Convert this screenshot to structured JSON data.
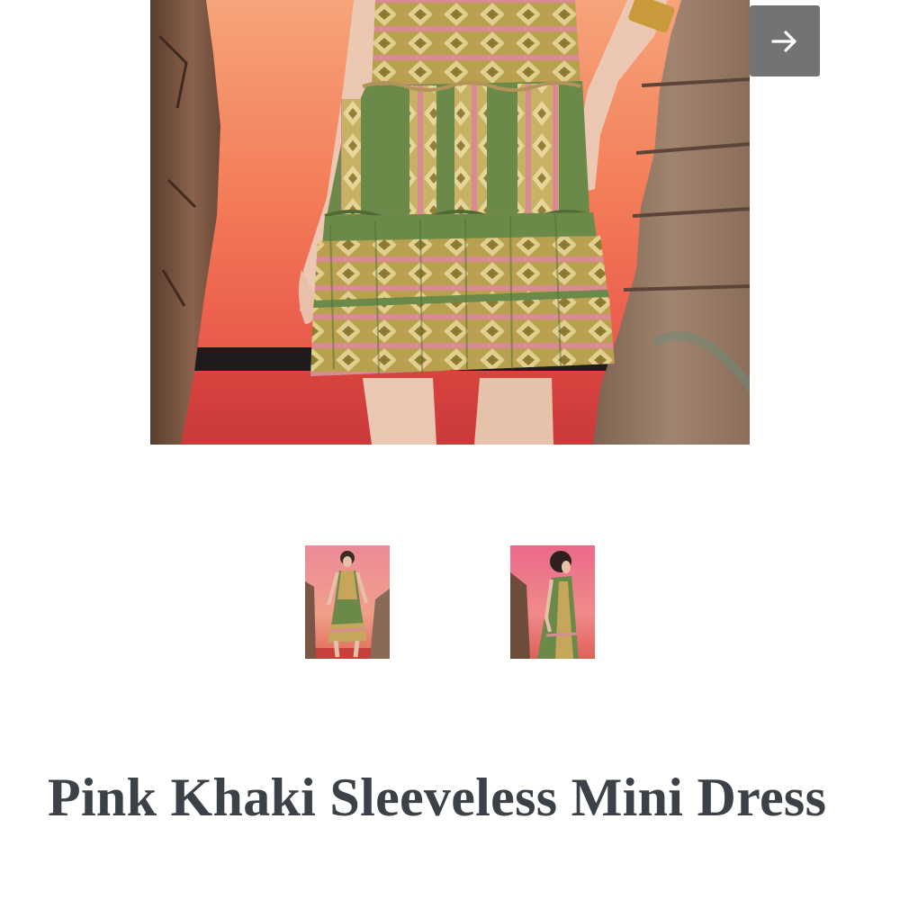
{
  "gallery": {
    "main_image_alt": "",
    "next_button_icon": "arrow-right-icon",
    "thumbnails": [
      {
        "view": "front"
      },
      {
        "view": "back"
      }
    ]
  },
  "product": {
    "title": "Pink Khaki Sleeveless Mini Dress"
  },
  "colors": {
    "title_text": "#3c4148",
    "next_button_bg": "#737373",
    "dress_khaki": "#6b8a4a",
    "dress_pink": "#d98a94",
    "background_orange": "#ee7a52"
  }
}
